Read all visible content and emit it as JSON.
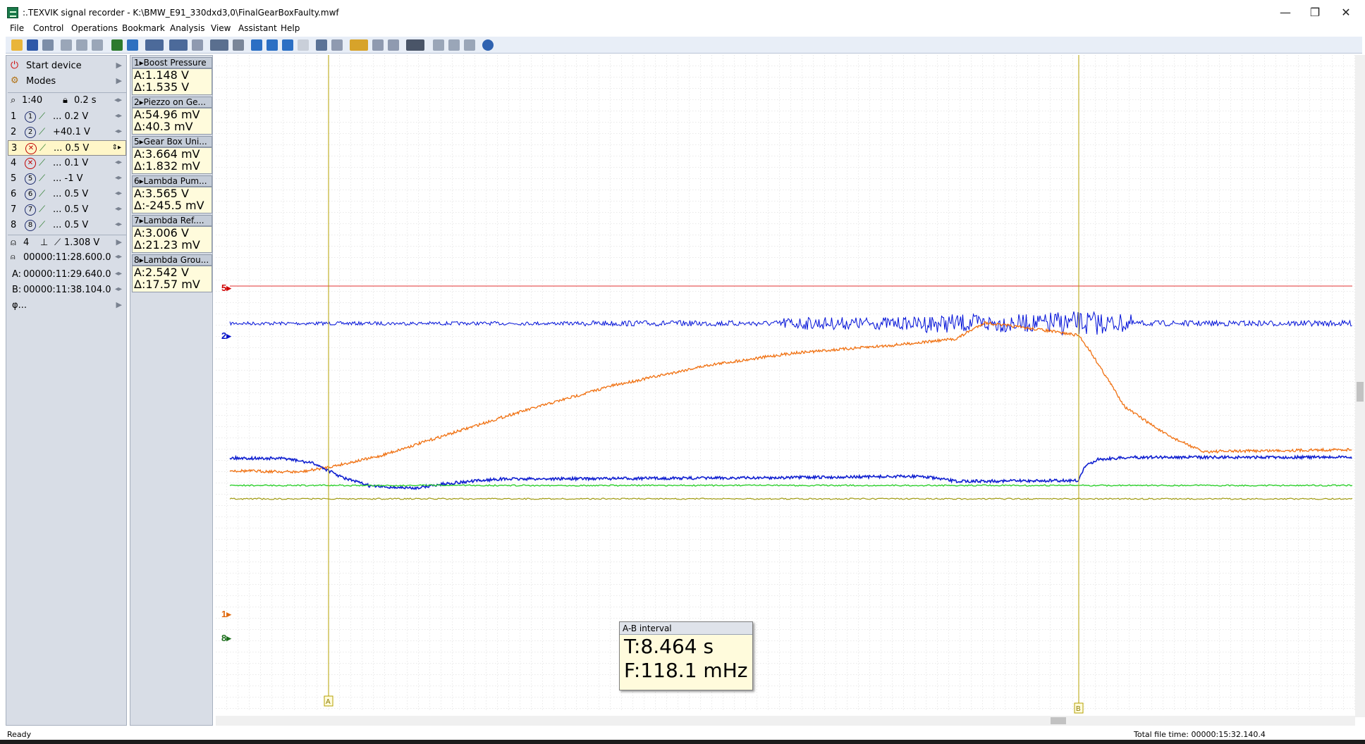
{
  "window": {
    "title": ":.TEXVIK  signal recorder - K:\\BMW_E91_330dxd3,0\\FinalGearBoxFaulty.mwf",
    "minimize_glyph": "—",
    "maximize_glyph": "❐",
    "close_glyph": "✕"
  },
  "menu": [
    "File",
    "Control",
    "Operations",
    "Bookmark",
    "Analysis",
    "View",
    "Assistant",
    "Help"
  ],
  "left_panel": {
    "start_device": "Start device",
    "modes": "Modes",
    "zoom": "1:40",
    "timebase": "0.2 s",
    "channels": [
      {
        "num": "1",
        "glyph": "1",
        "scale": "... 0.2 V"
      },
      {
        "num": "2",
        "glyph": "2",
        "scale": "+40.1 V"
      },
      {
        "num": "3",
        "glyph": "✕",
        "scale": "... 0.5 V"
      },
      {
        "num": "4",
        "glyph": "✕",
        "scale": "... 0.1 V"
      },
      {
        "num": "5",
        "glyph": "5",
        "scale": "... -1 V"
      },
      {
        "num": "6",
        "glyph": "6",
        "scale": "... 0.5 V"
      },
      {
        "num": "7",
        "glyph": "7",
        "scale": "... 0.5 V"
      },
      {
        "num": "8",
        "glyph": "8",
        "scale": "... 0.5 V"
      }
    ],
    "trigger_channel": "4",
    "trigger_level": "1.308 V",
    "trigger_time": "00000:11:28.600.0",
    "cursor_a": "00000:11:29.640.0",
    "cursor_b": "00000:11:38.104.0",
    "phi": "φ..."
  },
  "measurements": [
    {
      "head": "1▸Boost Pressure",
      "a": "A:1.148 V",
      "d": "Δ:1.535 V"
    },
    {
      "head": "2▸Piezzo on Ge...",
      "a": "A:54.96 mV",
      "d": "Δ:40.3 mV"
    },
    {
      "head": "5▸Gear Box Uni...",
      "a": "A:3.664 mV",
      "d": "Δ:1.832 mV"
    },
    {
      "head": "6▸Lambda Pum...",
      "a": "A:3.565 V",
      "d": "Δ:-245.5 mV"
    },
    {
      "head": "7▸Lambda Ref....",
      "a": "A:3.006 V",
      "d": "Δ:21.23 mV"
    },
    {
      "head": "8▸Lambda Grou...",
      "a": "A:2.542 V",
      "d": "Δ:17.57 mV"
    }
  ],
  "plot": {
    "markers": [
      {
        "label": "5▸",
        "color": "#d00000"
      },
      {
        "label": "2▸",
        "color": "#0010c8"
      },
      {
        "label": "1▸",
        "color": "#e06a10"
      },
      {
        "label": "8▸",
        "color": "#1b6e1b"
      }
    ],
    "cursor_a_label": "A",
    "cursor_b_label": "B",
    "colors": {
      "boost": "#f07010",
      "piezo": "#0010d8",
      "gearbox_mid": "#1020d0",
      "lambda": "#22cc22",
      "olive": "#a09a10",
      "ref": "#e03030",
      "cursor": "#b5a000"
    }
  },
  "ab_interval": {
    "title": "A-B interval",
    "t": "T:8.464 s",
    "f": "F:118.1 mHz"
  },
  "status": {
    "left": "Ready",
    "right": "Total file time: 00000:15:32.140.4"
  }
}
